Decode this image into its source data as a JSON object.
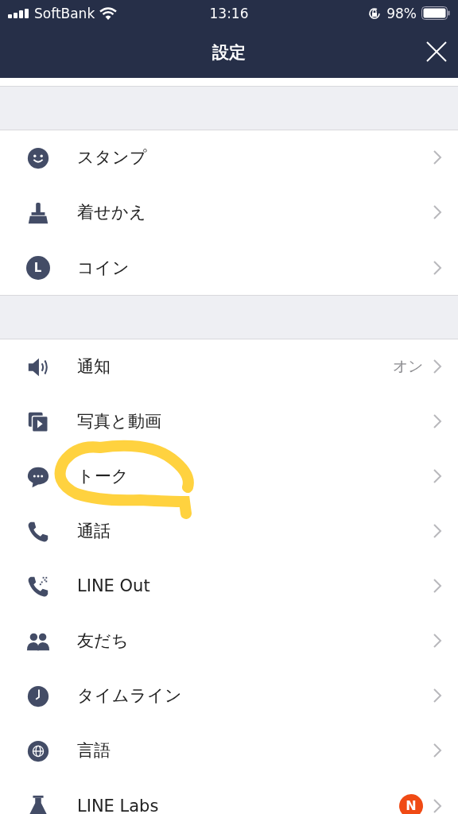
{
  "status_bar": {
    "carrier": "SoftBank",
    "time": "13:16",
    "battery": "98%"
  },
  "nav": {
    "title": "設定"
  },
  "sections": [
    {
      "items": [
        {
          "kind": "smiley",
          "label": "スタンプ"
        },
        {
          "kind": "brush",
          "label": "着せかえ"
        },
        {
          "kind": "coin",
          "icon_letter": "L",
          "label": "コイン"
        }
      ]
    },
    {
      "items": [
        {
          "kind": "speaker",
          "label": "通知",
          "value": "オン"
        },
        {
          "kind": "media",
          "label": "写真と動画"
        },
        {
          "kind": "chat",
          "label": "トーク",
          "highlighted": true
        },
        {
          "kind": "phone",
          "label": "通話"
        },
        {
          "kind": "phone-dots",
          "label": "LINE Out"
        },
        {
          "kind": "people",
          "label": "友だち"
        },
        {
          "kind": "clock",
          "label": "タイムライン"
        },
        {
          "kind": "globe",
          "label": "言語"
        },
        {
          "kind": "flask",
          "label": "LINE Labs",
          "badge": "N"
        }
      ]
    }
  ]
}
